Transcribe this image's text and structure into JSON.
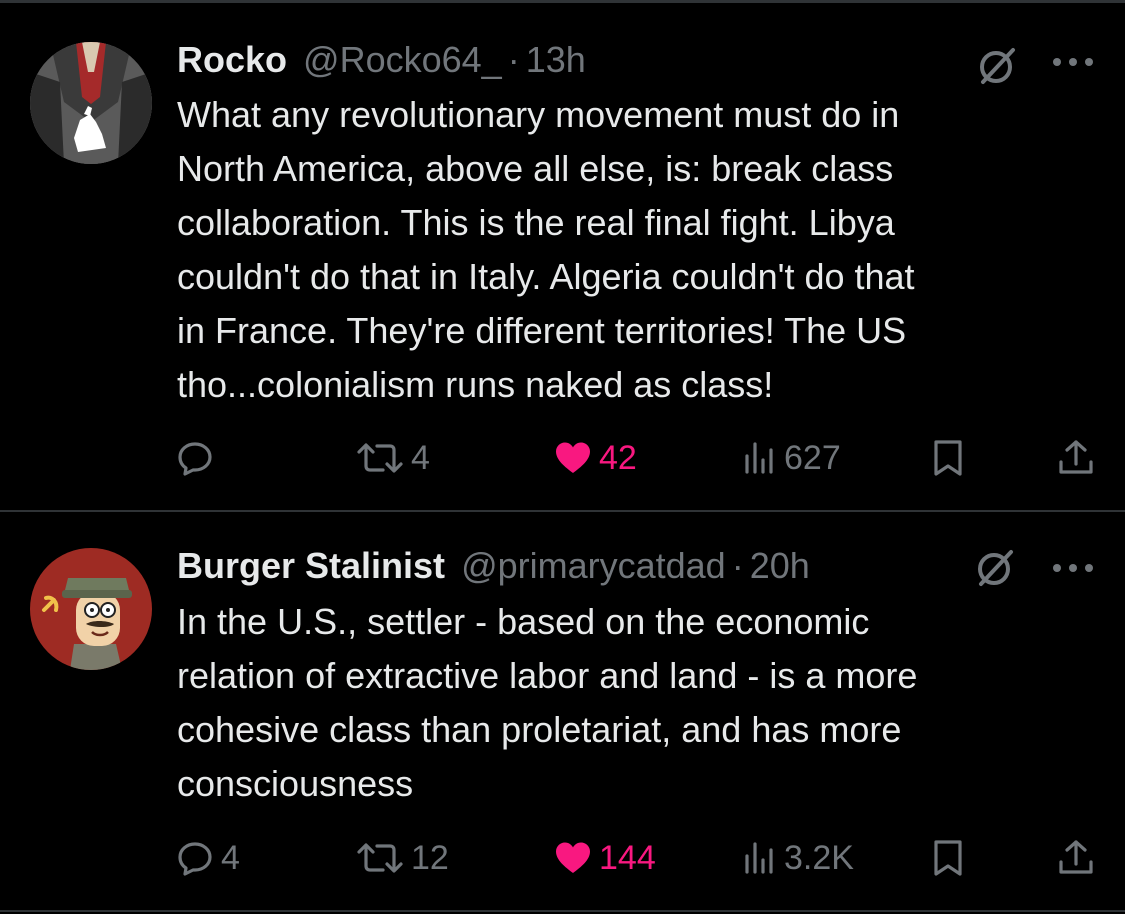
{
  "tweets": [
    {
      "display_name": "Rocko",
      "handle": "@Rocko64_",
      "separator": "·",
      "time": "13h",
      "text": "What any revolutionary movement must do in\nNorth America, above all else, is: break class\ncollaboration. This is the real final fight. Libya\ncouldn't do that in Italy. Algeria couldn't do that\nin France. They're different territories! The US\ntho...colonialism runs naked as class!",
      "actions": {
        "replies": "",
        "reposts": "4",
        "likes": "42",
        "views": "627"
      },
      "avatar_icon": "raised-fist-avatar"
    },
    {
      "display_name": "Burger Stalinist",
      "handle": "@primarycatdad",
      "separator": "·",
      "time": "20h",
      "text": "In the U.S., settler - based on the economic\nrelation of extractive labor and land - is a more\ncohesive class than proletariat, and has more\nconsciousness",
      "actions": {
        "replies": "4",
        "reposts": "12",
        "likes": "144",
        "views": "3.2K"
      },
      "avatar_icon": "cartoon-character-avatar"
    }
  ],
  "colors": {
    "background": "#000000",
    "text": "#e7e9ea",
    "muted": "#71767b",
    "like": "#f91880",
    "divider": "#2f3336"
  },
  "icons": [
    "grok-icon",
    "more-icon",
    "reply-icon",
    "repost-icon",
    "like-icon",
    "views-icon",
    "bookmark-icon",
    "share-icon"
  ]
}
